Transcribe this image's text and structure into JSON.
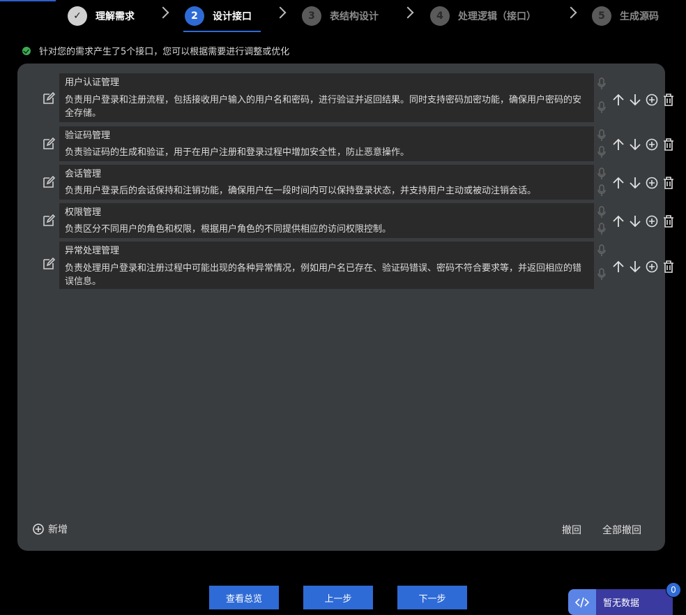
{
  "steps": [
    {
      "num": "✓",
      "label": "理解需求",
      "state": "done"
    },
    {
      "num": "2",
      "label": "设计接口",
      "state": "active"
    },
    {
      "num": "3",
      "label": "表结构设计",
      "state": "pending"
    },
    {
      "num": "4",
      "label": "处理逻辑（接口）",
      "state": "pending"
    },
    {
      "num": "5",
      "label": "生成源码",
      "state": "pending"
    }
  ],
  "notice": "针对您的需求产生了5个接口，您可以根据需要进行调整或优化",
  "interfaces": [
    {
      "title": "用户认证管理",
      "desc": "负责用户登录和注册流程，包括接收用户输入的用户名和密码，进行验证并返回结果。同时支持密码加密功能，确保用户密码的安全存储。"
    },
    {
      "title": "验证码管理",
      "desc": "负责验证码的生成和验证，用于在用户注册和登录过程中增加安全性，防止恶意操作。"
    },
    {
      "title": "会话管理",
      "desc": "负责用户登录后的会话保持和注销功能，确保用户在一段时间内可以保持登录状态，并支持用户主动或被动注销会话。"
    },
    {
      "title": "权限管理",
      "desc": "负责区分不同用户的角色和权限，根据用户角色的不同提供相应的访问权限控制。"
    },
    {
      "title": "异常处理管理",
      "desc": "负责处理用户登录和注册过程中可能出现的各种异常情况，例如用户名已存在、验证码错误、密码不符合要求等，并返回相应的错误信息。"
    }
  ],
  "panel": {
    "add_label": "新增",
    "undo_label": "撤回",
    "undo_all_label": "全部撤回"
  },
  "footer": {
    "overview": "查看总览",
    "prev": "上一步",
    "next": "下一步"
  },
  "dock": {
    "nodata": "暂无数据",
    "badge": "0"
  },
  "colors": {
    "accent": "#2f6bd6",
    "panel": "#3a3d40",
    "row": "#2a2a2a",
    "success": "#3dab52"
  }
}
